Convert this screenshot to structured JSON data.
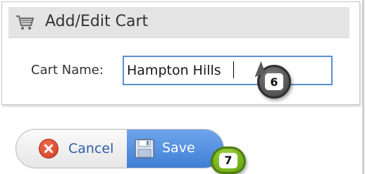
{
  "panel": {
    "title": "Add/Edit Cart",
    "icon": "cart-icon"
  },
  "form": {
    "cart_name_label": "Cart Name:",
    "cart_name_value": "Hampton Hills"
  },
  "buttons": {
    "cancel_label": "Cancel",
    "cancel_icon": "cancel-icon",
    "save_label": "Save",
    "save_icon": "save-icon"
  },
  "callouts": {
    "step_6": "6",
    "step_7": "7"
  },
  "colors": {
    "input_border": "#5d8ed4",
    "save_button": "#4f8ae0",
    "cancel_text": "#2f5da8",
    "step_6": "#5b5b5b",
    "step_7": "#79b51e"
  }
}
